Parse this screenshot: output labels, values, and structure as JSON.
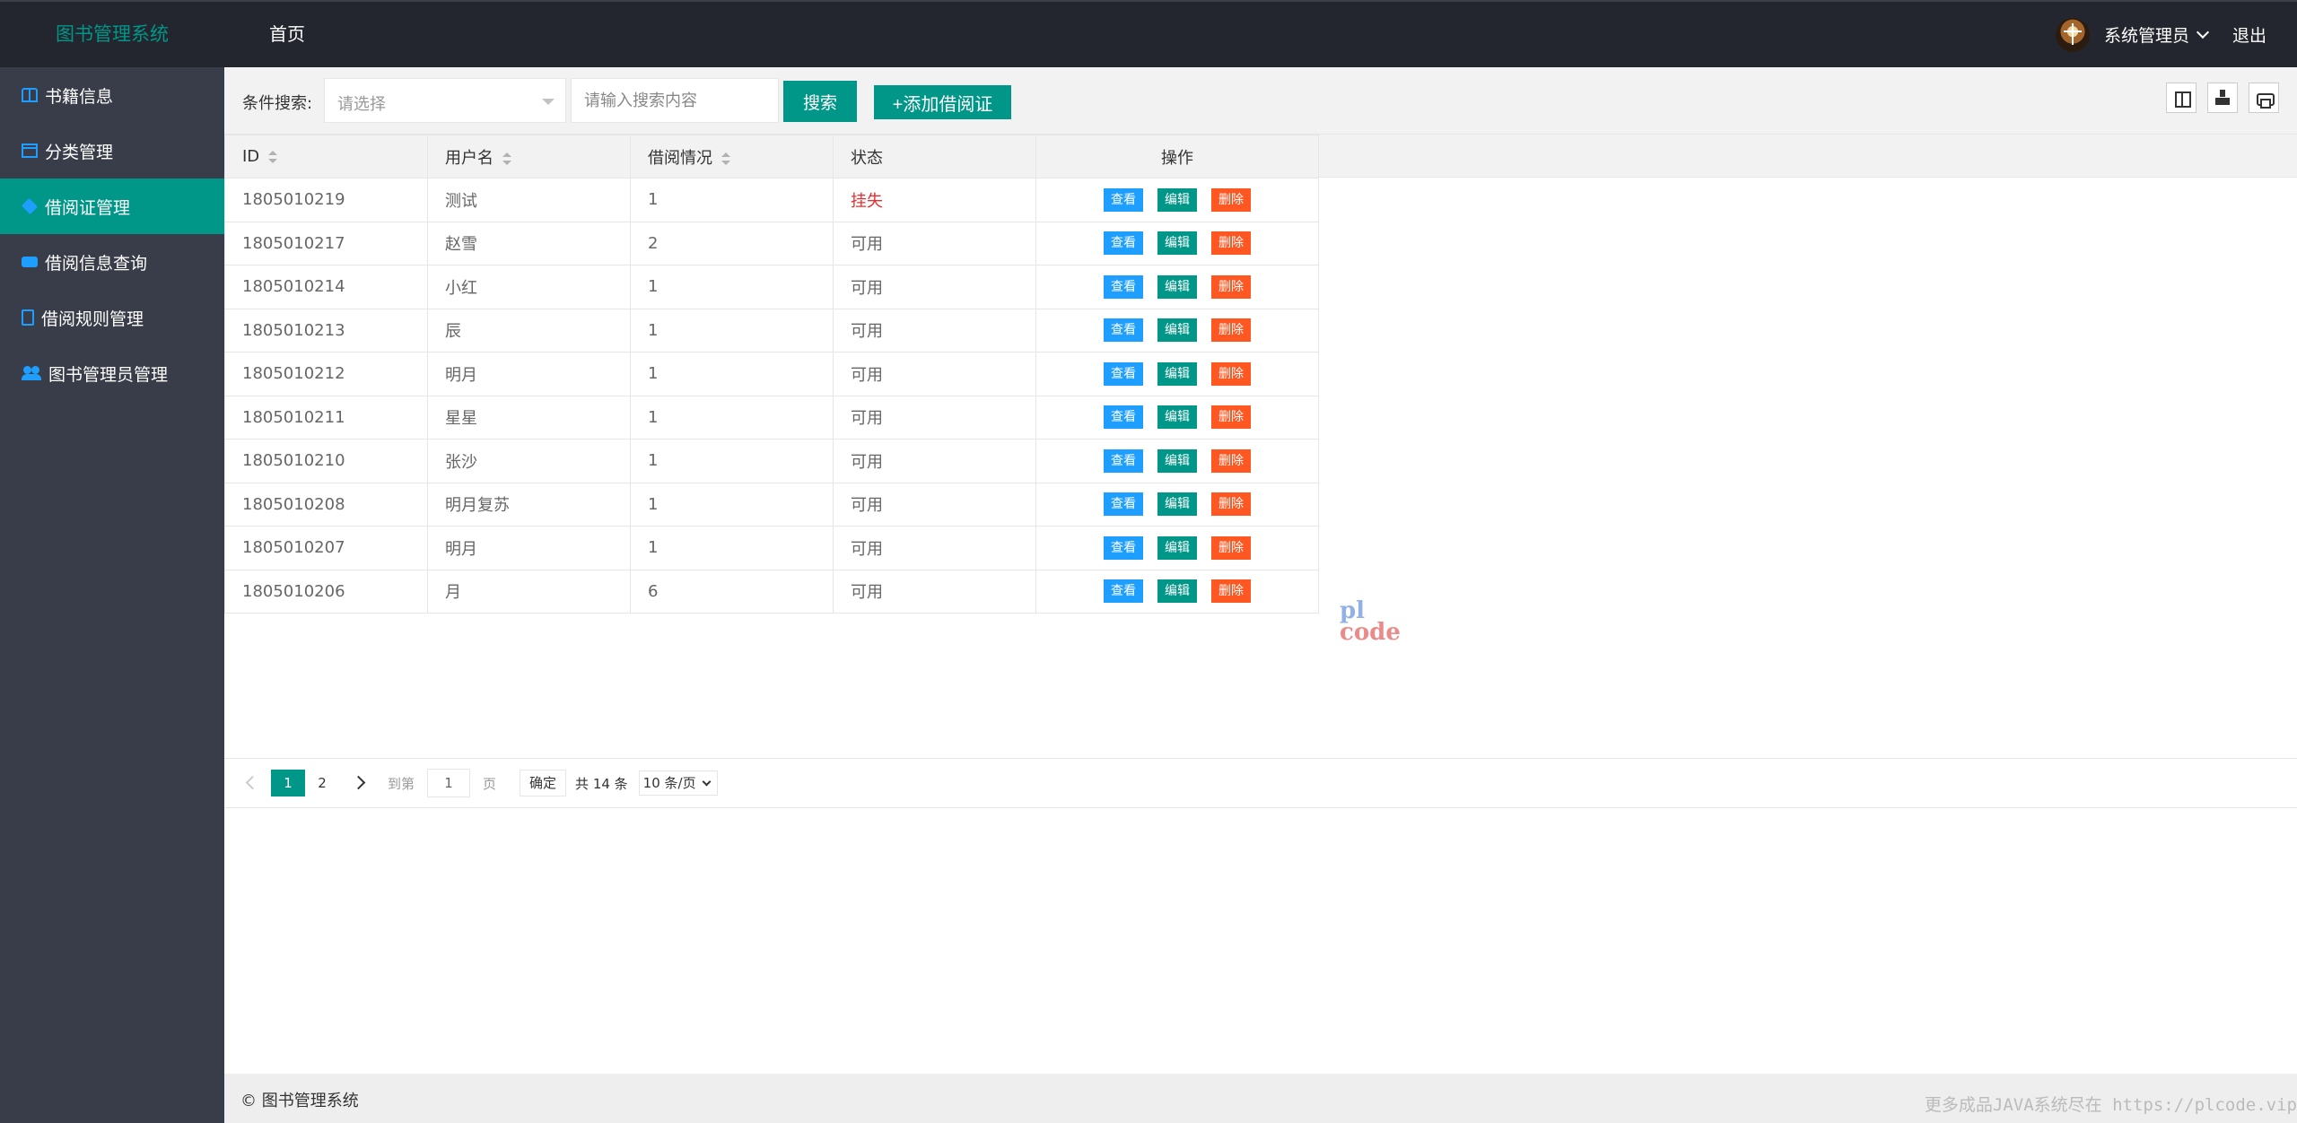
{
  "header": {
    "logo": "图书管理系统",
    "nav_home": "首页",
    "user_name": "系统管理员",
    "logout": "退出"
  },
  "sidebar": {
    "items": [
      {
        "label": "书籍信息",
        "icon": "book-icon"
      },
      {
        "label": "分类管理",
        "icon": "calendar-icon"
      },
      {
        "label": "借阅证管理",
        "icon": "cube-icon",
        "active": true
      },
      {
        "label": "借阅信息查询",
        "icon": "chat-icon"
      },
      {
        "label": "借阅规则管理",
        "icon": "note-icon"
      },
      {
        "label": "图书管理员管理",
        "icon": "users-icon"
      }
    ]
  },
  "toolbar": {
    "search_label": "条件搜索:",
    "select_placeholder": "请选择",
    "input_placeholder": "请输入搜索内容",
    "search_button": "搜索",
    "add_button": "+添加借阅证"
  },
  "table": {
    "columns": [
      "ID",
      "用户名",
      "借阅情况",
      "状态",
      "操作"
    ],
    "actions": {
      "view": "查看",
      "edit": "编辑",
      "delete": "删除"
    },
    "rows": [
      {
        "id": "1805010219",
        "user": "测试",
        "borrow": "1",
        "status": "挂失"
      },
      {
        "id": "1805010217",
        "user": "赵雪",
        "borrow": "2",
        "status": "可用"
      },
      {
        "id": "1805010214",
        "user": "小红",
        "borrow": "1",
        "status": "可用"
      },
      {
        "id": "1805010213",
        "user": "辰",
        "borrow": "1",
        "status": "可用"
      },
      {
        "id": "1805010212",
        "user": "明月",
        "borrow": "1",
        "status": "可用"
      },
      {
        "id": "1805010211",
        "user": "星星",
        "borrow": "1",
        "status": "可用"
      },
      {
        "id": "1805010210",
        "user": "张沙",
        "borrow": "1",
        "status": "可用"
      },
      {
        "id": "1805010208",
        "user": "明月复苏",
        "borrow": "1",
        "status": "可用"
      },
      {
        "id": "1805010207",
        "user": "明月",
        "borrow": "1",
        "status": "可用"
      },
      {
        "id": "1805010206",
        "user": "月",
        "borrow": "6",
        "status": "可用"
      }
    ]
  },
  "pager": {
    "pages": [
      "1",
      "2"
    ],
    "current": "1",
    "goto_label": "到第",
    "goto_value": "1",
    "page_unit": "页",
    "confirm": "确定",
    "total": "共 14 条",
    "page_size": "10 条/页"
  },
  "watermark": {
    "line1": "pl",
    "line2": "code"
  },
  "footer": {
    "copyright": "© 图书管理系统",
    "right_text": "更多成品JAVA系统尽在 https://plcode.vip"
  },
  "colors": {
    "accent": "#009688",
    "header_bg": "#23262e",
    "sidebar_bg": "#393d49",
    "view": "#1e9fff",
    "delete": "#ff5722",
    "lost": "#e62e2e"
  }
}
